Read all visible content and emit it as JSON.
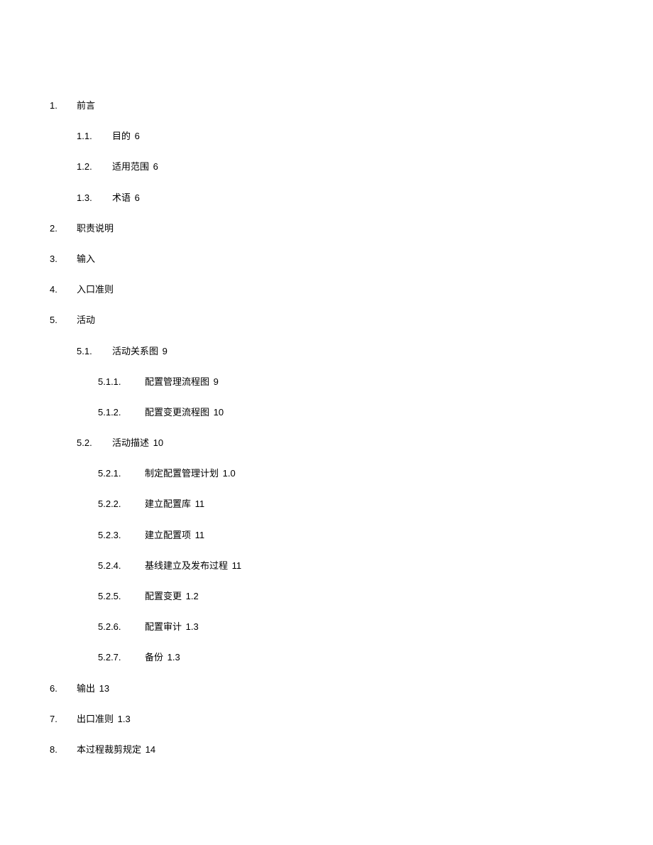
{
  "toc": [
    {
      "level": 1,
      "num": "1.",
      "title": "前言",
      "page": ""
    },
    {
      "level": 2,
      "num": "1.1.",
      "title": "目的",
      "page": "6"
    },
    {
      "level": 2,
      "num": "1.2.",
      "title": "适用范围",
      "page": "6"
    },
    {
      "level": 2,
      "num": "1.3.",
      "title": "术语",
      "page": "6"
    },
    {
      "level": 1,
      "num": "2.",
      "title": "职责说明",
      "page": ""
    },
    {
      "level": 1,
      "num": "3.",
      "title": "输入",
      "page": ""
    },
    {
      "level": 1,
      "num": "4.",
      "title": "入口准则",
      "page": ""
    },
    {
      "level": 1,
      "num": "5.",
      "title": "活动",
      "page": ""
    },
    {
      "level": 2,
      "num": "5.1.",
      "title": "活动关系图",
      "page": "9"
    },
    {
      "level": 3,
      "num": "5.1.1.",
      "title": "配置管理流程图",
      "page": "9"
    },
    {
      "level": 3,
      "num": "5.1.2.",
      "title": "配置变更流程图",
      "page": "10"
    },
    {
      "level": 2,
      "num": "5.2.",
      "title": "活动描述",
      "page": "10"
    },
    {
      "level": 3,
      "num": "5.2.1.",
      "title": "制定配置管理计划",
      "page": "1.0"
    },
    {
      "level": 3,
      "num": "5.2.2.",
      "title": "建立配置库",
      "page": "11"
    },
    {
      "level": 3,
      "num": "5.2.3.",
      "title": "建立配置项",
      "page": "11"
    },
    {
      "level": 3,
      "num": "5.2.4.",
      "title": "基线建立及发布过程",
      "page": "11"
    },
    {
      "level": 3,
      "num": "5.2.5.",
      "title": "配置变更",
      "page": "1.2"
    },
    {
      "level": 3,
      "num": "5.2.6.",
      "title": "配置审计",
      "page": "1.3"
    },
    {
      "level": 3,
      "num": "5.2.7.",
      "title": "备份",
      "page": "1.3"
    },
    {
      "level": 1,
      "num": "6.",
      "title": "输出",
      "page": "13"
    },
    {
      "level": 1,
      "num": "7.",
      "title": "出口准则",
      "page": "1.3"
    },
    {
      "level": 1,
      "num": "8.",
      "title": "本过程裁剪规定",
      "page": "14"
    }
  ]
}
